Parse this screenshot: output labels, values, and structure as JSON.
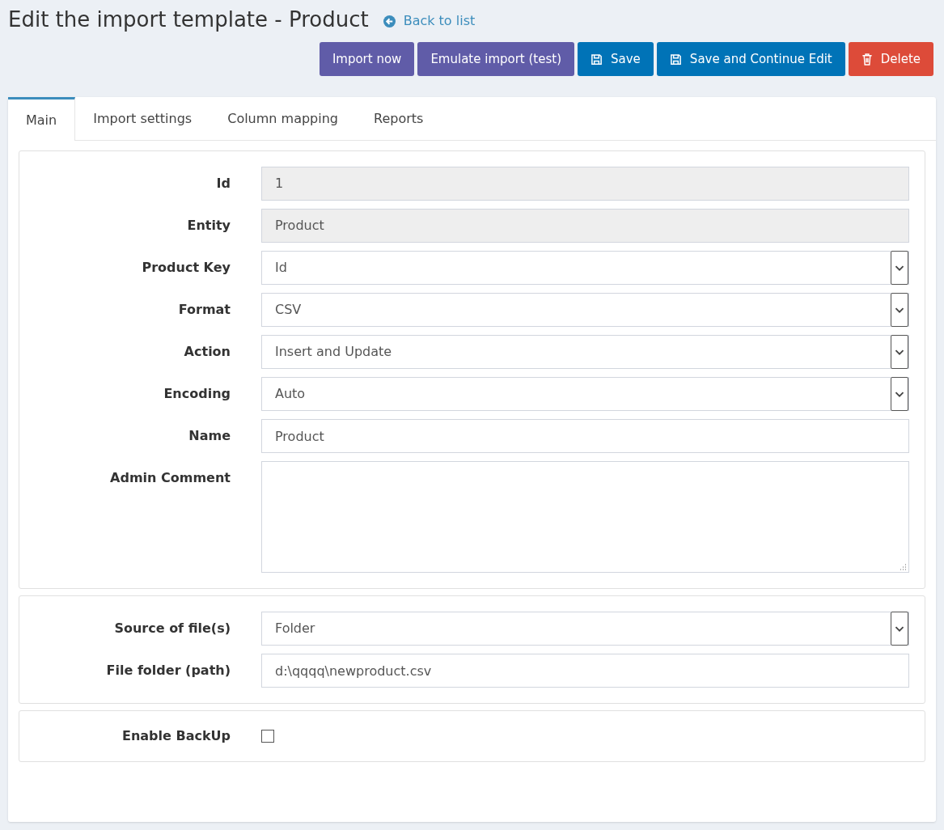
{
  "header": {
    "title": "Edit the import template - Product",
    "back_link": "Back to list"
  },
  "buttons": [
    {
      "label": "Import now",
      "kind": "action"
    },
    {
      "label": "Emulate import (test)",
      "kind": "action"
    },
    {
      "label": "Save",
      "kind": "save"
    },
    {
      "label": "Save and Continue Edit",
      "kind": "save"
    },
    {
      "label": "Delete",
      "kind": "delete"
    }
  ],
  "tabs": [
    {
      "label": "Main",
      "selected": true
    },
    {
      "label": "Import settings",
      "selected": false
    },
    {
      "label": "Column mapping",
      "selected": false
    },
    {
      "label": "Reports",
      "selected": false
    }
  ],
  "sections": [
    {
      "fields": [
        {
          "label": "Id",
          "kind": "readonly",
          "value": "1"
        },
        {
          "label": "Entity",
          "kind": "readonly",
          "value": "Product"
        },
        {
          "label": "Product Key",
          "kind": "select",
          "value": "Id"
        },
        {
          "label": "Format",
          "kind": "select",
          "value": "CSV"
        },
        {
          "label": "Action",
          "kind": "select",
          "value": "Insert and Update"
        },
        {
          "label": "Encoding",
          "kind": "select",
          "value": "Auto"
        },
        {
          "label": "Name",
          "kind": "text",
          "value": "Product"
        },
        {
          "label": "Admin Comment",
          "kind": "textarea"
        }
      ]
    },
    {
      "fields": [
        {
          "label": "Source of file(s)",
          "kind": "select",
          "value": "Folder"
        },
        {
          "label": "File folder (path)",
          "kind": "text",
          "value": "d:\\qqqq\\newproduct.csv"
        }
      ]
    },
    {
      "fields": [
        {
          "label": "Enable BackUp",
          "kind": "checkbox",
          "checked": false
        }
      ]
    }
  ]
}
